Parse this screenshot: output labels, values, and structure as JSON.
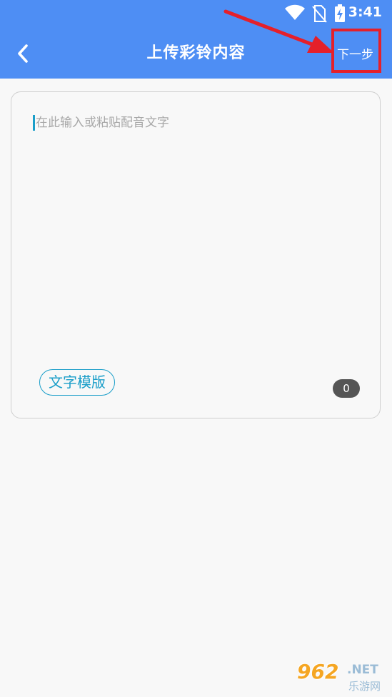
{
  "status_bar": {
    "time": "3:41",
    "icons": [
      "wifi-icon",
      "no-sim-icon",
      "battery-charging-icon"
    ]
  },
  "header": {
    "title": "上传彩铃内容",
    "next_label": "下一步",
    "background": "#4e8ef4"
  },
  "editor": {
    "placeholder": "在此输入或粘贴配音文字",
    "value": "",
    "template_label": "文字模版",
    "char_count": "0",
    "accent": "#1a9ec9"
  },
  "annotation": {
    "highlight_color": "#e5202a"
  },
  "watermark": {
    "logo": "962",
    "domain": ".NET",
    "subtitle": "乐游网"
  }
}
